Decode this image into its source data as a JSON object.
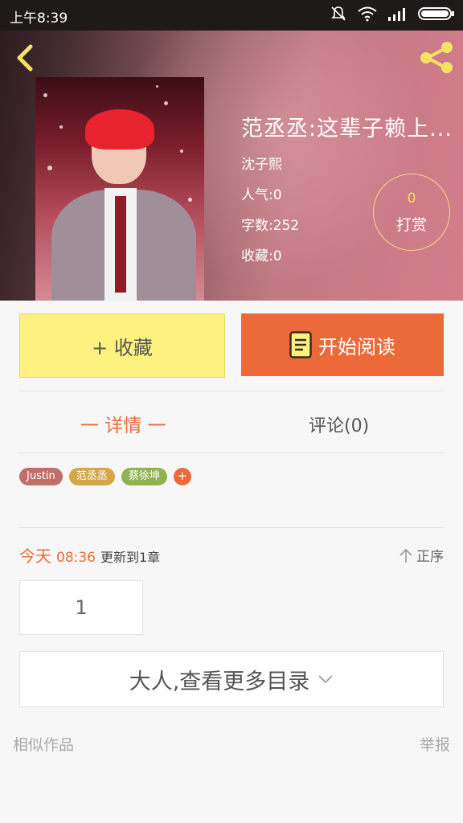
{
  "status_bar": {
    "time": "上午8:39"
  },
  "book": {
    "title": "范丞丞:这辈子赖上...",
    "author": "沈子熙",
    "popularity": "人气:0",
    "word_count": "字数:252",
    "favorites": "收藏:0"
  },
  "reward": {
    "count": "0",
    "label": "打赏"
  },
  "actions": {
    "favorite_label": "+ 收藏",
    "read_label": "开始阅读"
  },
  "tabs": {
    "details": "一 详情 一",
    "comments": "评论(0)"
  },
  "tags": [
    {
      "label": "Justin",
      "color": "#c0706a"
    },
    {
      "label": "范丞丞",
      "color": "#d4a84a"
    },
    {
      "label": "蔡徐坤",
      "color": "#8fb44e"
    }
  ],
  "tag_add": "+",
  "update": {
    "today": "今天",
    "time": "08:36",
    "text": "更新到1章"
  },
  "sort_label": "正序",
  "chapter_number": "1",
  "more_chapters": "大人,查看更多目录",
  "footer": {
    "similar": "相似作品",
    "report": "举报"
  },
  "colors": {
    "accent": "#ec6a3a",
    "favorite_bg": "#fdf27f"
  }
}
